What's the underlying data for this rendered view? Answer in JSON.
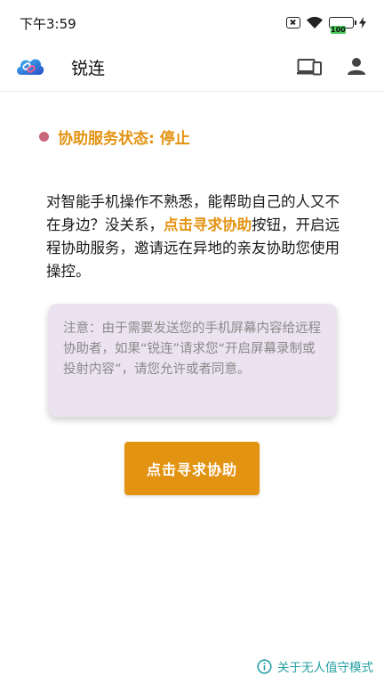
{
  "status_bar": {
    "time": "下午3:59",
    "battery_level": "100"
  },
  "app_bar": {
    "title": "锐连",
    "icons": [
      "cloud-link-logo-icon",
      "devices-icon",
      "account-icon"
    ]
  },
  "service_status": {
    "label": "协助服务状态: 停止",
    "dot_color": "#c9667a"
  },
  "description": {
    "part1": "对智能手机操作不熟悉，能帮助自己的人又不在身边？没关系，",
    "highlight": "点击寻求协助",
    "part2": "按钮，开启远程协助服务，邀请远在异地的亲友协助您使用操控。"
  },
  "note": {
    "text": "注意：由于需要发送您的手机屏幕内容给远程协助者，如果“锐连”请求您“开启屏幕录制或投射内容”，请您允许或者同意。"
  },
  "primary_button": {
    "label": "点击寻求协助"
  },
  "footer": {
    "link_label": "关于无人值守模式"
  },
  "colors": {
    "accent": "#e39312",
    "link": "#27a0a2",
    "note_bg": "#ebe3ef"
  }
}
